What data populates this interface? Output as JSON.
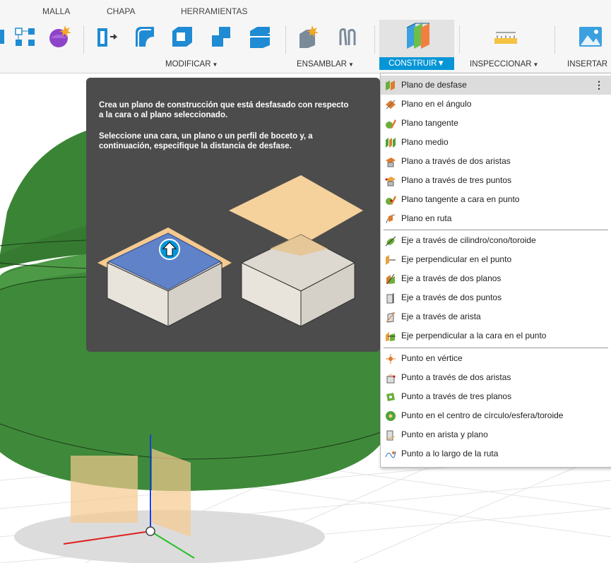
{
  "ribbon": {
    "tabs": [
      "MALLA",
      "CHAPA",
      "HERRAMIENTAS"
    ],
    "groups": {
      "modificar": "MODIFICAR",
      "ensamblar": "ENSAMBLAR",
      "construir": "CONSTRUIR",
      "inspeccionar": "INSPECCIONAR",
      "insertar": "INSERTAR"
    },
    "caret": "▼"
  },
  "tooltip": {
    "line1": "Crea un plano de construcción que está desfasado con respecto a la cara o al plano seleccionado.",
    "line2": "Seleccione una cara, un plano o un perfil de boceto y, a continuación, especifique la distancia de desfase."
  },
  "menu": {
    "more_icon": "⋮",
    "items": [
      {
        "label": "Plano de desfase",
        "icon": "offset-plane-icon",
        "color": "#e07b2c"
      },
      {
        "label": "Plano en el ángulo",
        "icon": "plane-at-angle-icon",
        "color": "#e07b2c"
      },
      {
        "label": "Plano tangente",
        "icon": "tangent-plane-icon",
        "color": "#6cae3a"
      },
      {
        "label": "Plano medio",
        "icon": "midplane-icon",
        "color": "#4ea53a"
      },
      {
        "label": "Plano a través de dos aristas",
        "icon": "plane-two-edges-icon",
        "color": "#e07b2c"
      },
      {
        "label": "Plano a través de tres puntos",
        "icon": "plane-three-points-icon",
        "color": "#e8a33c"
      },
      {
        "label": "Plano tangente a cara en punto",
        "icon": "plane-tangent-face-point-icon",
        "color": "#6cae3a"
      },
      {
        "label": "Plano en ruta",
        "icon": "plane-along-path-icon",
        "color": "#e07b2c"
      },
      {
        "label": "Eje a través de cilindro/cono/toroide",
        "icon": "axis-cylinder-icon",
        "color": "#6cae3a"
      },
      {
        "label": "Eje perpendicular en el punto",
        "icon": "axis-perpendicular-point-icon",
        "color": "#e8a33c"
      },
      {
        "label": "Eje a través de dos planos",
        "icon": "axis-two-planes-icon",
        "color": "#e07b2c"
      },
      {
        "label": "Eje a través de dos puntos",
        "icon": "axis-two-points-icon",
        "color": "#e8a33c"
      },
      {
        "label": "Eje a través de arista",
        "icon": "axis-edge-icon",
        "color": "#e8a33c"
      },
      {
        "label": "Eje perpendicular a la cara en el punto",
        "icon": "axis-perpendicular-face-icon",
        "color": "#6cae3a"
      },
      {
        "label": "Punto en vértice",
        "icon": "point-vertex-icon",
        "color": "#e07b2c"
      },
      {
        "label": "Punto a través de dos aristas",
        "icon": "point-two-edges-icon",
        "color": "#e07b2c"
      },
      {
        "label": "Punto a través de tres planos",
        "icon": "point-three-planes-icon",
        "color": "#6cae3a"
      },
      {
        "label": "Punto en el centro de círculo/esfera/toroide",
        "icon": "point-center-icon",
        "color": "#4ea53a"
      },
      {
        "label": "Punto en arista y plano",
        "icon": "point-edge-plane-icon",
        "color": "#e8a33c"
      },
      {
        "label": "Punto a lo largo de la ruta",
        "icon": "point-along-path-icon",
        "color": "#e07b2c"
      }
    ]
  },
  "colors": {
    "accent": "#0696d7",
    "tooltip_bg": "#4c4c4c",
    "model_green": "#3f8a3a",
    "plane_orange": "#f5c98f"
  }
}
